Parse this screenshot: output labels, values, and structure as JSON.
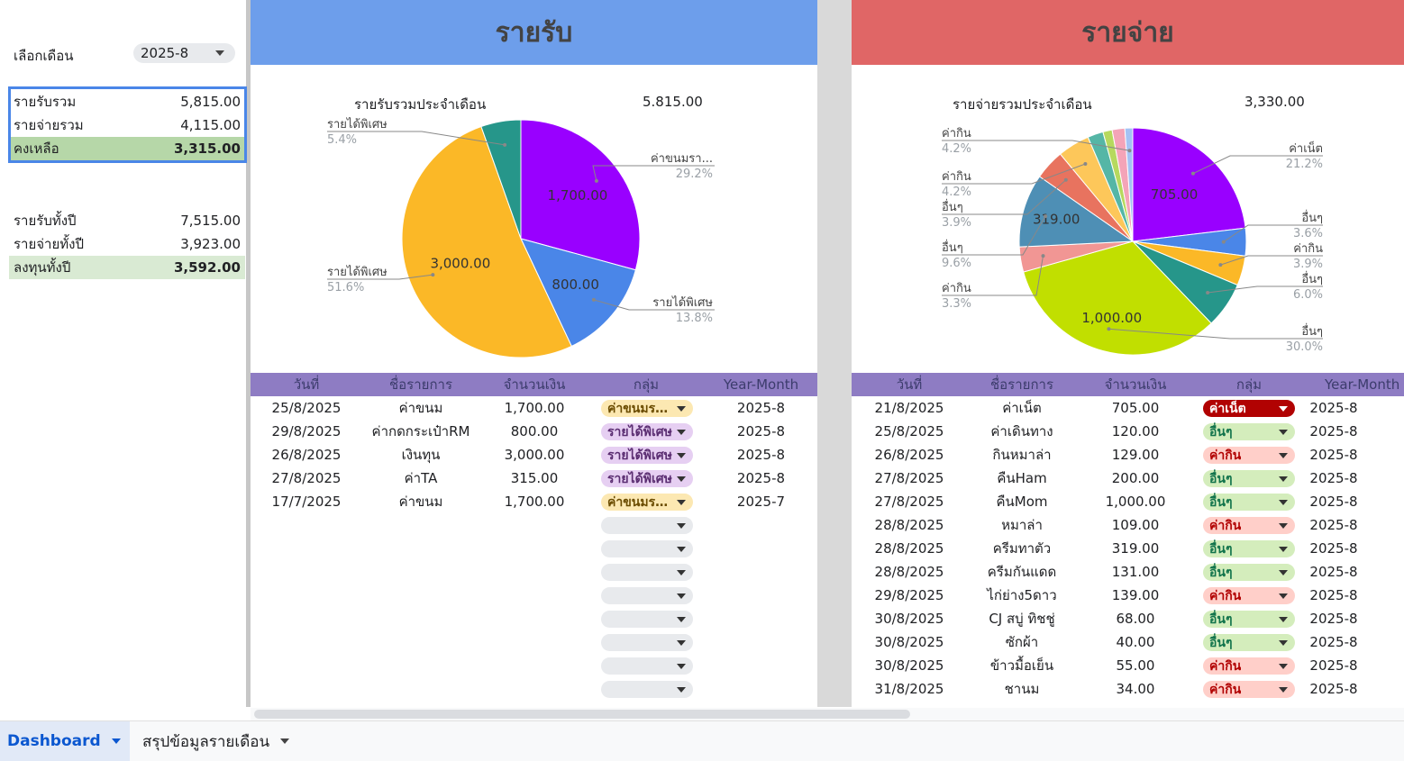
{
  "left": {
    "month_label": "เลือกเดือน",
    "month_value": "2025-8",
    "summary": [
      {
        "label": "รายรับรวม",
        "value": "5,815.00"
      },
      {
        "label": "รายจ่ายรวม",
        "value": "4,115.00"
      },
      {
        "label": "คงเหลือ",
        "value": "3,315.00"
      }
    ],
    "yearly": [
      {
        "label": "รายรับทั้งปี",
        "value": "7,515.00"
      },
      {
        "label": "รายจ่ายทั้งปี",
        "value": "3,923.00"
      },
      {
        "label": "ลงทุนทั้งปี",
        "value": "3,592.00"
      }
    ]
  },
  "income": {
    "title": "รายรับ",
    "total_label": "รายรับรวมประจำเดือน",
    "total_value": "5.815.00",
    "columns": [
      "วันที่",
      "ชื่อรายการ",
      "จำนวนเงิน",
      "กลุ่ม",
      "Year-Month"
    ],
    "rows": [
      {
        "date": "25/8/2025",
        "name": "ค่าขนม",
        "amount": "1,700.00",
        "group": "ค่าขนมรายเดือน",
        "ym": "2025-8",
        "color": "yellow"
      },
      {
        "date": "29/8/2025",
        "name": "ค่ากดกระเป๋าRM",
        "amount": "800.00",
        "group": "รายได้พิเศษ",
        "ym": "2025-8",
        "color": "purple"
      },
      {
        "date": "26/8/2025",
        "name": "เงินทุน",
        "amount": "3,000.00",
        "group": "รายได้พิเศษ",
        "ym": "2025-8",
        "color": "purple"
      },
      {
        "date": "27/8/2025",
        "name": "ค่าTA",
        "amount": "315.00",
        "group": "รายได้พิเศษ",
        "ym": "2025-8",
        "color": "purple"
      },
      {
        "date": "17/7/2025",
        "name": "ค่าขนม",
        "amount": "1,700.00",
        "group": "ค่าขนมรายเดือน",
        "ym": "2025-7",
        "color": "yellow"
      }
    ],
    "empty_chip_count": 8
  },
  "expense": {
    "title": "รายจ่าย",
    "total_label": "รายจ่ายรวมประจำเดือน",
    "total_value": "3,330.00",
    "columns": [
      "วันที่",
      "ชื่อรายการ",
      "จำนวนเงิน",
      "กลุ่ม",
      "Year-Month"
    ],
    "rows": [
      {
        "date": "21/8/2025",
        "name": "ค่าเน็ต",
        "amount": "705.00",
        "group": "ค่าเน็ต",
        "ym": "2025-8",
        "color": "red"
      },
      {
        "date": "25/8/2025",
        "name": "ค่าเดินทาง",
        "amount": "120.00",
        "group": "อื่นๆ",
        "ym": "2025-8",
        "color": "green"
      },
      {
        "date": "26/8/2025",
        "name": "กินหมาล่า",
        "amount": "129.00",
        "group": "ค่ากิน",
        "ym": "2025-8",
        "color": "pink"
      },
      {
        "date": "27/8/2025",
        "name": "คืนHam",
        "amount": "200.00",
        "group": "อื่นๆ",
        "ym": "2025-8",
        "color": "green"
      },
      {
        "date": "27/8/2025",
        "name": "คืนMom",
        "amount": "1,000.00",
        "group": "อื่นๆ",
        "ym": "2025-8",
        "color": "green"
      },
      {
        "date": "28/8/2025",
        "name": "หมาล่า",
        "amount": "109.00",
        "group": "ค่ากิน",
        "ym": "2025-8",
        "color": "pink"
      },
      {
        "date": "28/8/2025",
        "name": "ครีมทาตัว",
        "amount": "319.00",
        "group": "อื่นๆ",
        "ym": "2025-8",
        "color": "green"
      },
      {
        "date": "28/8/2025",
        "name": "ครีมกันแดด",
        "amount": "131.00",
        "group": "อื่นๆ",
        "ym": "2025-8",
        "color": "green"
      },
      {
        "date": "29/8/2025",
        "name": "ไก่ย่าง5ดาว",
        "amount": "139.00",
        "group": "ค่ากิน",
        "ym": "2025-8",
        "color": "pink"
      },
      {
        "date": "30/8/2025",
        "name": "CJ สบู่ ทิชชู่",
        "amount": "68.00",
        "group": "อื่นๆ",
        "ym": "2025-8",
        "color": "green"
      },
      {
        "date": "30/8/2025",
        "name": "ซักผ้า",
        "amount": "40.00",
        "group": "อื่นๆ",
        "ym": "2025-8",
        "color": "green"
      },
      {
        "date": "30/8/2025",
        "name": "ข้าวมื้อเย็น",
        "amount": "55.00",
        "group": "ค่ากิน",
        "ym": "2025-8",
        "color": "pink"
      },
      {
        "date": "31/8/2025",
        "name": "ชานม",
        "amount": "34.00",
        "group": "ค่ากิน",
        "ym": "2025-8",
        "color": "pink"
      }
    ]
  },
  "chart_data": [
    {
      "type": "pie",
      "slices": [
        {
          "label": "ค่าขนมรา...",
          "value": 1700,
          "value_label": "1,700.00",
          "percent": "29.2%",
          "color": "#9900ff"
        },
        {
          "label": "รายได้พิเศษ",
          "value": 800,
          "value_label": "800.00",
          "percent": "13.8%",
          "color": "#4a86e8"
        },
        {
          "label": "รายได้พิเศษ",
          "value": 3000,
          "value_label": "3,000.00",
          "percent": "51.6%",
          "color": "#fbb827"
        },
        {
          "label": "รายได้พิเศษ",
          "value": 315,
          "value_label": "",
          "percent": "5.4%",
          "color": "#26968a"
        }
      ]
    },
    {
      "type": "pie",
      "slices": [
        {
          "label": "ค่าเน็ต",
          "value": 705,
          "value_label": "705.00",
          "percent": "21.2%",
          "color": "#9900ff"
        },
        {
          "label": "อื่นๆ",
          "value": 120,
          "value_label": "",
          "percent": "3.6%",
          "color": "#4a86e8"
        },
        {
          "label": "ค่ากิน",
          "value": 129,
          "value_label": "",
          "percent": "3.9%",
          "color": "#fbb827"
        },
        {
          "label": "อื่นๆ",
          "value": 200,
          "value_label": "",
          "percent": "6.0%",
          "color": "#26968a"
        },
        {
          "label": "อื่นๆ",
          "value": 1000,
          "value_label": "1,000.00",
          "percent": "30.0%",
          "color": "#c1df00"
        },
        {
          "label": "ค่ากิน",
          "value": 109,
          "value_label": "",
          "percent": "3.3%",
          "color": "#f19694"
        },
        {
          "label": "อื่นๆ",
          "value": 319,
          "value_label": "319.00",
          "percent": "9.6%",
          "color": "#4e8fb5"
        },
        {
          "label": "อื่นๆ",
          "value": 131,
          "value_label": "",
          "percent": "3.9%",
          "color": "#e8735f"
        },
        {
          "label": "ค่ากิน",
          "value": 139,
          "value_label": "",
          "percent": "4.2%",
          "color": "#fdc75a"
        },
        {
          "label": "",
          "value": 68,
          "value_label": "",
          "percent": "",
          "color": "#55b6a6"
        },
        {
          "label": "",
          "value": 40,
          "value_label": "",
          "percent": "",
          "color": "#b6d95e"
        },
        {
          "label": "",
          "value": 55,
          "value_label": "",
          "percent": "",
          "color": "#f4a4b8"
        },
        {
          "label": "ค่ากิน",
          "value": 34,
          "value_label": "",
          "percent": "4.2%",
          "color": "#a4c2f4"
        }
      ]
    }
  ],
  "tabs": [
    {
      "label": "Dashboard"
    },
    {
      "label": "สรุปข้อมูลรายเดือน"
    }
  ]
}
